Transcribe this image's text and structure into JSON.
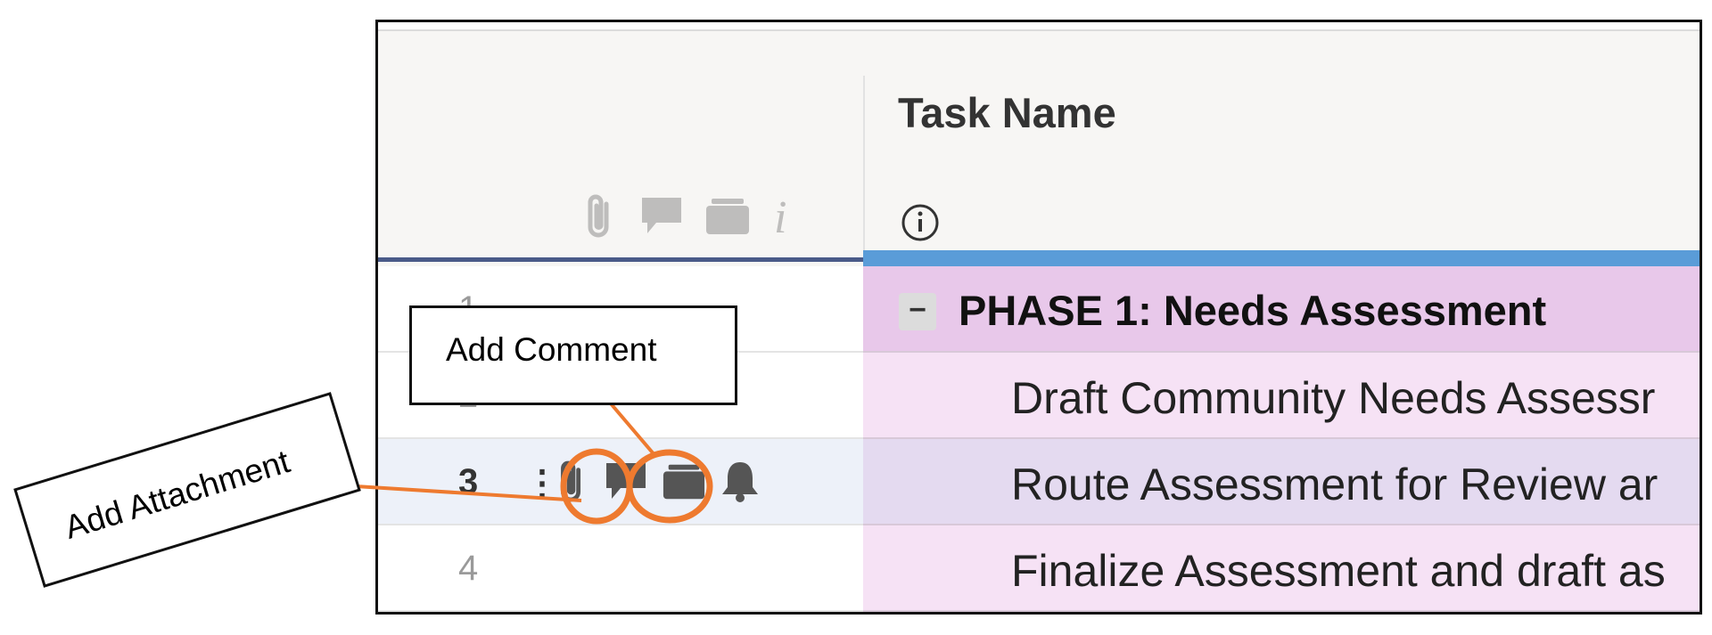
{
  "header": {
    "task_name": "Task Name"
  },
  "rows": [
    {
      "number": "1",
      "text": "PHASE 1: Needs Assessment",
      "type": "phase"
    },
    {
      "number": "2",
      "text": "Draft Community Needs Assessr"
    },
    {
      "number": "3",
      "text": "Route Assessment for Review ar"
    },
    {
      "number": "4",
      "text": "Finalize Assessment and draft as"
    }
  ],
  "callouts": {
    "comment": "Add Comment",
    "attachment": "Add Attachment"
  },
  "icons": {
    "header": [
      "paperclip-icon",
      "comment-icon",
      "proofing-icon",
      "info-italic-icon"
    ],
    "row3": [
      "kebab-menu-icon",
      "paperclip-icon",
      "comment-icon",
      "proofing-icon",
      "bell-icon"
    ]
  },
  "colors": {
    "highlight": "#ee7a2f",
    "phase_row": "#e8c8ea",
    "task_row": "#f6e2f5",
    "selected_row": "#e4daf0",
    "header_underline": "#5a9cd8"
  }
}
